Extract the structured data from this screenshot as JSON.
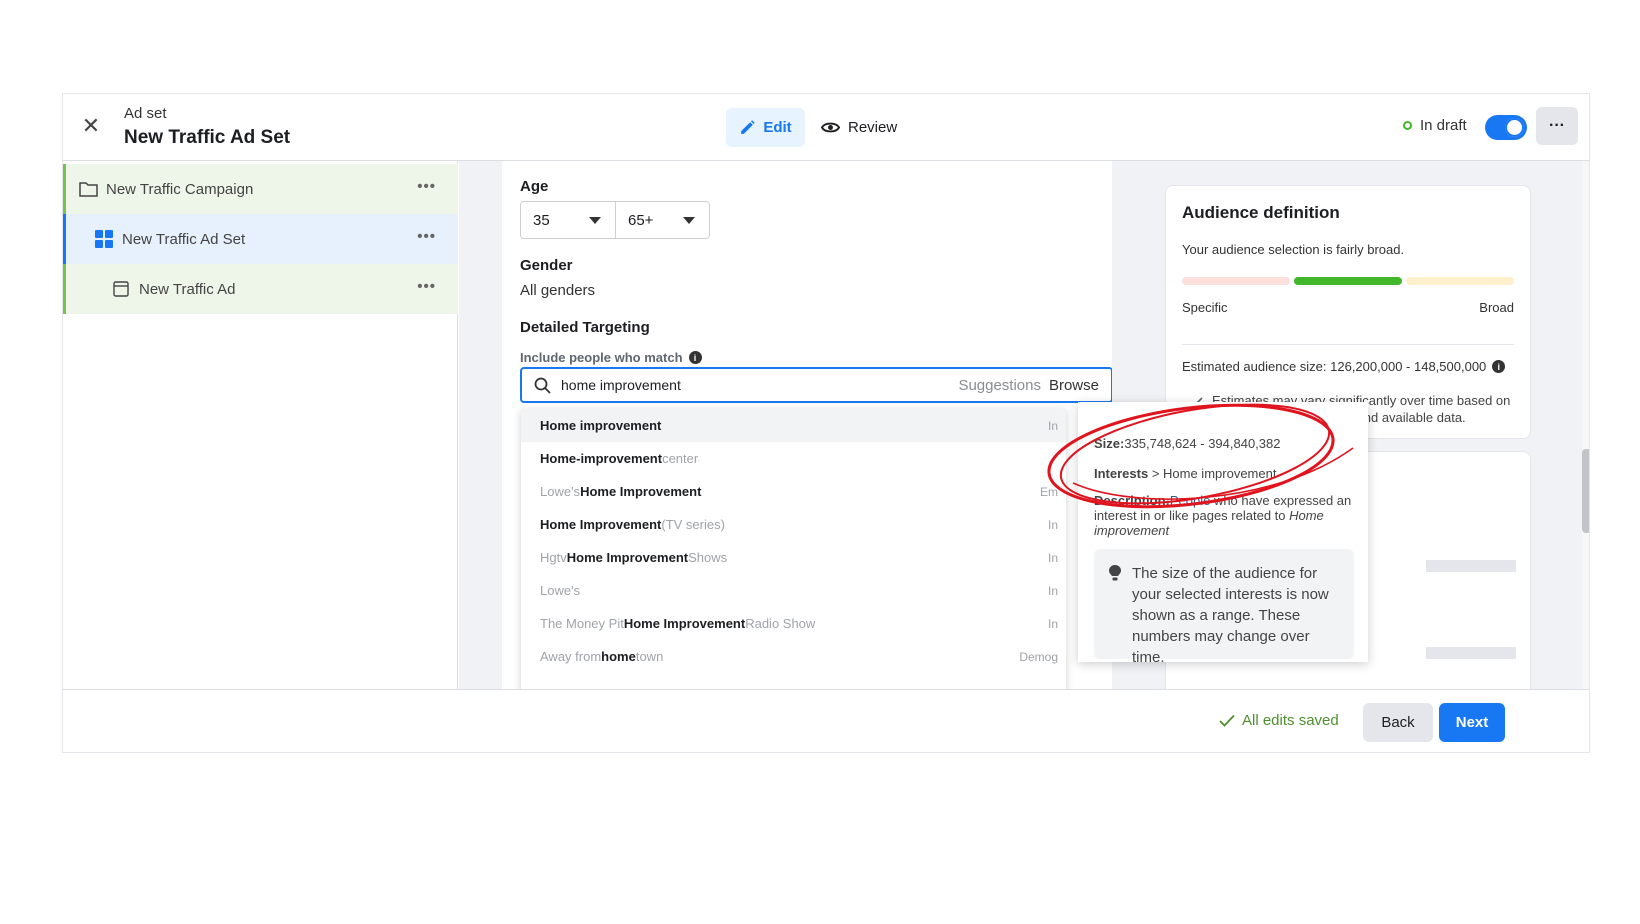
{
  "header": {
    "subtitle": "Ad set",
    "title": "New Traffic Ad Set",
    "edit_label": "Edit",
    "review_label": "Review",
    "status": "In draft",
    "more_label": "···"
  },
  "sidebar": {
    "items": [
      {
        "label": "New Traffic Campaign",
        "icon": "folder-icon"
      },
      {
        "label": "New Traffic Ad Set",
        "icon": "grid-icon"
      },
      {
        "label": "New Traffic Ad",
        "icon": "ad-icon"
      }
    ],
    "more_label": "•••"
  },
  "form": {
    "age_label": "Age",
    "age_min": "35",
    "age_max": "65+",
    "gender_label": "Gender",
    "gender_value": "All genders",
    "targeting_label": "Detailed Targeting",
    "targeting_hint": "Include people who match",
    "search_value": "home improvement",
    "suggestions_label": "Suggestions",
    "browse_label": "Browse"
  },
  "results": [
    {
      "pre": "",
      "bold": "Home improvement",
      "post": "",
      "right": "In"
    },
    {
      "pre": "",
      "bold": "Home-improvement",
      "post": " center",
      "right": ""
    },
    {
      "pre": "Lowe's ",
      "bold": "Home Improvement",
      "post": "",
      "right": "Em"
    },
    {
      "pre": "",
      "bold": "Home Improvement",
      "post": " (TV series)",
      "right": "In"
    },
    {
      "pre": "Hgtv ",
      "bold": "Home Improvement",
      "post": " Shows",
      "right": "In"
    },
    {
      "pre": "Lowe's",
      "bold": "",
      "post": "",
      "right": "In"
    },
    {
      "pre": "The Money Pit ",
      "bold": "Home Improvement",
      "post": " Radio Show",
      "right": "In"
    },
    {
      "pre": "Away from ",
      "bold": "home",
      "post": "town",
      "right": "Demog"
    }
  ],
  "tooltip": {
    "size_label": "Size:",
    "size_value": "335,748,624 - 394,840,382",
    "interests_label": "Interests",
    "interests_path": " > Home improvement",
    "desc_label": "Description:",
    "desc_link": "People",
    "desc_text": " who have expressed an interest in or like pages related to ",
    "desc_topic": "Home improvement",
    "note": "The size of the audience for your selected interests is now shown as a range. These numbers may change over time."
  },
  "audience": {
    "title": "Audience definition",
    "description": "Your audience selection is fairly broad.",
    "specific_label": "Specific",
    "broad_label": "Broad",
    "estimated": "Estimated audience size: 126,200,000 - 148,500,000",
    "estimate_note": "Estimates may vary significantly over time based on your targeting selections and available data.",
    "level": "fairly broad"
  },
  "footer": {
    "saved": "All edits saved",
    "back_label": "Back",
    "next_label": "Next"
  },
  "colors": {
    "accent": "#1877f2",
    "success": "#42b72a",
    "annotation": "#e0141e"
  }
}
